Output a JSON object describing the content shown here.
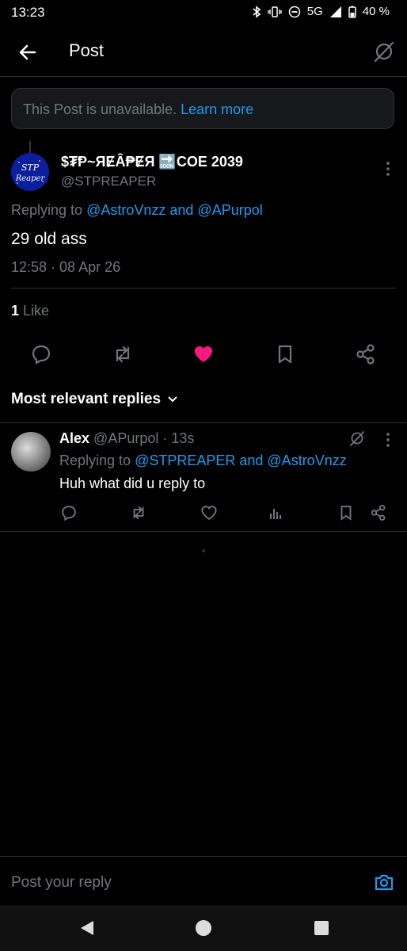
{
  "status_bar": {
    "time": "13:23",
    "network": "5G",
    "battery": "40 %"
  },
  "header": {
    "title": "Post"
  },
  "banner": {
    "text": "This Post is unavailable.",
    "link": "Learn more"
  },
  "post": {
    "display_name": "$₮Ᵽ~ЯɆȂ₱ɆЯ 🔜COE 2039",
    "handle": "@STPREAPER",
    "replying_prefix": "Replying to",
    "replying_users": "@AstroVnzz and @APurpol",
    "text": "29 old ass",
    "timestamp": "12:58 · 08 Apr 26",
    "like_count": "1",
    "like_label": "Like",
    "avatar_text_line1": "STP",
    "avatar_text_line2": "Reaper"
  },
  "replies_sort": {
    "label": "Most relevant replies"
  },
  "reply": {
    "display_name": "Alex",
    "handle_time": "@APurpol · 13s",
    "replying_prefix": "Replying to",
    "replying_users": "@STPREAPER and @AstroVnzz",
    "text": "Huh what did u reply to"
  },
  "compose": {
    "placeholder": "Post your reply"
  },
  "colors": {
    "accent": "#1d9bf0",
    "like": "#f91880",
    "muted": "#71767b",
    "divider": "#2f3336"
  },
  "icons": [
    "back-arrow-icon",
    "grok-icon",
    "more-icon",
    "reply-icon",
    "repost-icon",
    "like-icon",
    "bookmark-icon",
    "share-icon",
    "views-icon",
    "camera-icon",
    "chevron-down-icon"
  ]
}
